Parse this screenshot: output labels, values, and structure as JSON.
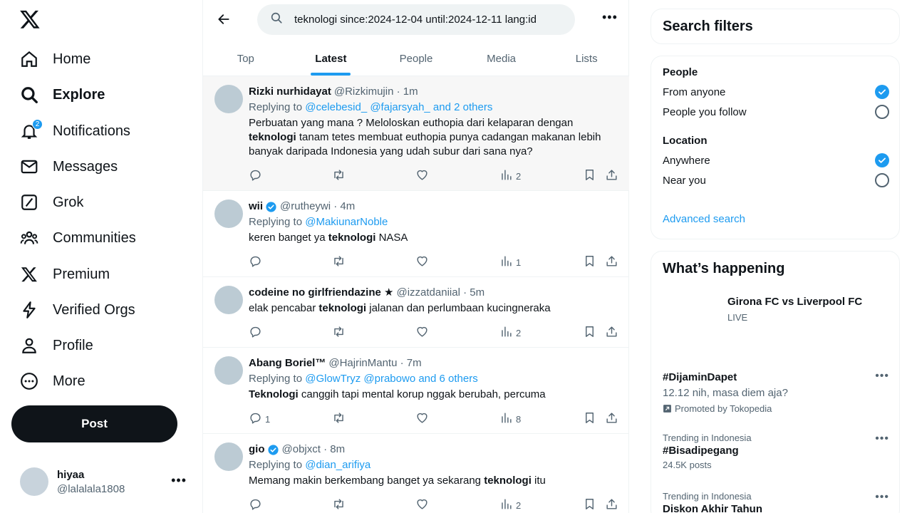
{
  "nav": {
    "items": [
      {
        "label": "Home",
        "icon": "home-icon"
      },
      {
        "label": "Explore",
        "icon": "search-icon"
      },
      {
        "label": "Notifications",
        "icon": "bell-icon",
        "badge": "2"
      },
      {
        "label": "Messages",
        "icon": "envelope-icon"
      },
      {
        "label": "Grok",
        "icon": "grok-icon"
      },
      {
        "label": "Communities",
        "icon": "people-icon"
      },
      {
        "label": "Premium",
        "icon": "x-logo-icon"
      },
      {
        "label": "Verified Orgs",
        "icon": "lightning-icon"
      },
      {
        "label": "Profile",
        "icon": "person-icon"
      },
      {
        "label": "More",
        "icon": "more-circle-icon"
      }
    ],
    "post_label": "Post"
  },
  "account": {
    "name": "hiyaa",
    "handle": "@lalalala1808"
  },
  "search": {
    "query": "teknologi since:2024-12-04 until:2024-12-11 lang:id"
  },
  "tabs": [
    "Top",
    "Latest",
    "People",
    "Media",
    "Lists"
  ],
  "tweets": [
    {
      "name": "Rizki nurhidayat",
      "handle": "@Rizkimujin · 1m",
      "reply_prefix": "Replying to ",
      "reply_to": "@celebesid_ @fajarsyah_ and 2 others",
      "text_a": "Perbuatan yang mana ? Meloloskan euthopia dari kelaparan dengan ",
      "keyword": "teknologi",
      "text_b": " tanam tetes membuat euthopia punya cadangan makanan lebih banyak daripada Indonesia yang udah subur dari sana nya?",
      "replies": "",
      "views": "2"
    },
    {
      "name": "wii",
      "handle": "@rutheywi · 4m",
      "reply_prefix": "Replying to ",
      "reply_to": "@MakiunarNoble",
      "text_a": "keren banget ya ",
      "keyword": "teknologi",
      "text_b": " NASA",
      "replies": "",
      "views": "1"
    },
    {
      "name": "codeine no girlfriendazine ★",
      "handle": "@izzatdaniial · 5m",
      "text_a": "elak pencabar ",
      "keyword": "teknologi",
      "text_b": " jalanan dan perlumbaan kucingneraka",
      "replies": "",
      "views": "2"
    },
    {
      "name": "Abang Boriel™",
      "handle": "@HajrinMantu · 7m",
      "reply_prefix": "Replying to ",
      "reply_to": "@GlowTryz @prabowo and 6 others",
      "text_a": "",
      "keyword": "Teknologi",
      "text_b": " canggih tapi mental korup nggak berubah, percuma",
      "replies": "1",
      "views": "8"
    },
    {
      "name": "gio",
      "handle": "@objxct · 8m",
      "reply_prefix": "Replying to ",
      "reply_to": "@dian_arifiya",
      "text_a": "Memang makin berkembang banget ya sekarang ",
      "keyword": "teknologi",
      "text_b": " itu",
      "replies": "",
      "views": "2"
    }
  ],
  "filters": {
    "title": "Search filters",
    "people_heading": "People",
    "people_options": [
      "From anyone",
      "People you follow"
    ],
    "location_heading": "Location",
    "location_options": [
      "Anywhere",
      "Near you"
    ],
    "advanced": "Advanced search"
  },
  "happening": {
    "title": "What’s happening",
    "event_title": "Girona FC vs Liverpool FC",
    "event_status": "LIVE",
    "promo_title": "#DijaminDapet",
    "promo_sub": "12.12 nih, masa diem aja?",
    "promo_by": "Promoted by Tokopedia",
    "trends": [
      {
        "context": "Trending in Indonesia",
        "title": "#Bisadipegang",
        "posts": "24.5K posts"
      },
      {
        "context": "Trending in Indonesia",
        "title": "Diskon Akhir Tahun"
      }
    ]
  },
  "colors": {
    "accent": "#1d9bf0",
    "text": "#0f1419",
    "muted": "#536471"
  }
}
